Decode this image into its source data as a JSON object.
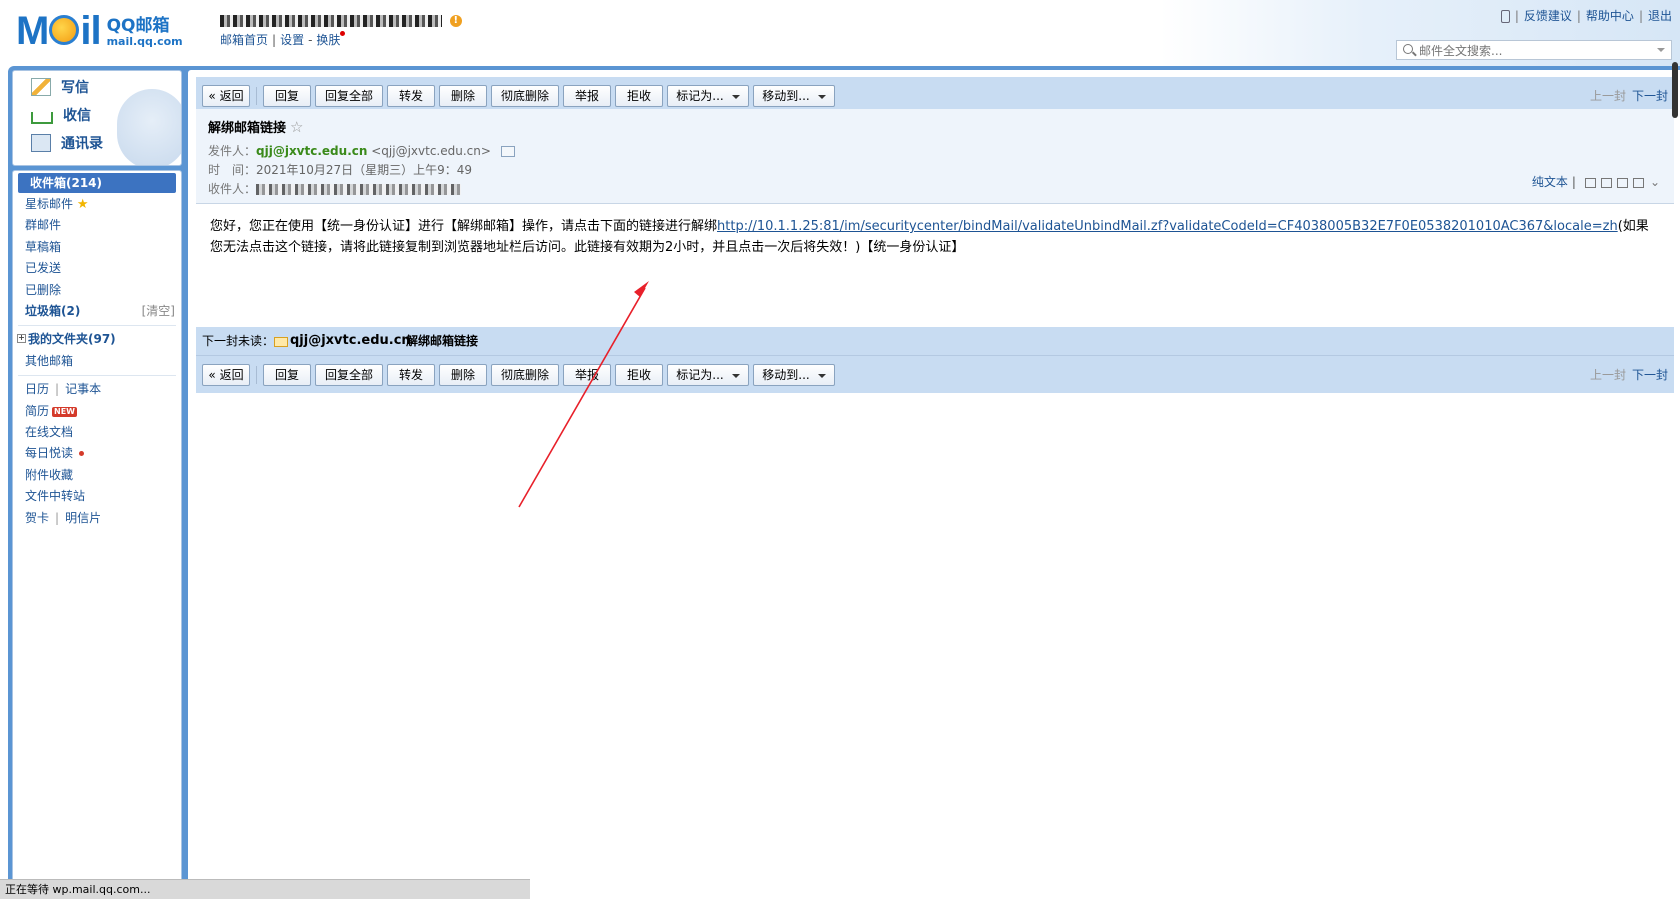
{
  "header": {
    "logo_word": "M il",
    "logo_cn": "QQ邮箱",
    "logo_domain": "mail.qq.com",
    "account_links": [
      "邮箱首页",
      "设置",
      "换肤"
    ],
    "top_links": [
      "反馈建议",
      "帮助中心",
      "退出"
    ],
    "search_placeholder": "邮件全文搜索..."
  },
  "sidebar": {
    "quick": [
      "写信",
      "收信",
      "通讯录"
    ],
    "inbox": "收件箱(214)",
    "starred": "星标邮件",
    "group": "群邮件",
    "drafts": "草稿箱",
    "sent": "已发送",
    "deleted": "已删除",
    "trash": "垃圾箱(2)",
    "trash_clear": "[清空]",
    "my_folders": "我的文件夹(97)",
    "other_mail": "其他邮箱",
    "calendar": "日历",
    "notes": "记事本",
    "resume": "简历",
    "resume_badge": "NEW",
    "docs": "在线文档",
    "daily": "每日悦读",
    "attachments": "附件收藏",
    "transfer": "文件中转站",
    "cards": "贺卡",
    "postcards": "明信片"
  },
  "toolbar": {
    "back": "« 返回",
    "reply": "回复",
    "reply_all": "回复全部",
    "forward": "转发",
    "delete": "删除",
    "perm_delete": "彻底删除",
    "report": "举报",
    "reject": "拒收",
    "mark_as": "标记为...",
    "move_to": "移动到...",
    "prev": "上一封",
    "next": "下一封"
  },
  "mail": {
    "subject": "解绑邮箱链接",
    "from_label": "发件人：",
    "from_name": "qjj@jxvtc.edu.cn",
    "from_addr": "<qjj@jxvtc.edu.cn>",
    "time_label": "时　间：",
    "time": "2021年10月27日（星期三）上午9：49",
    "to_label": "收件人：",
    "plain_text": "纯文本",
    "body_prefix": "您好，您正在使用【统一身份认证】进行【解绑邮箱】操作，请点击下面的链接进行解绑",
    "body_link": "http://10.1.1.25:81/im/securitycenter/bindMail/validateUnbindMail.zf?validateCodeId=CF4038005B32E7F0E0538201010AC367&locale=zh",
    "body_suffix": "(如果您无法点击这个链接，请将此链接复制到浏览器地址栏后访问。此链接有效期为2小时，并且点击一次后将失效！)【统一身份认证】"
  },
  "next_unread": {
    "label": "下一封未读：",
    "from": "qjj@jxvtc.edu.cn",
    "subject": "解绑邮箱链接"
  },
  "status": {
    "text": "正在等待 wp.mail.qq.com..."
  },
  "colors": {
    "frame_blue": "#5b95d3",
    "toolbar_blue": "#c8dcf2",
    "selected": "#3c73c1",
    "link": "#1e5494",
    "sender_green": "#3a8a1a",
    "annotation_red": "#e8202a"
  }
}
